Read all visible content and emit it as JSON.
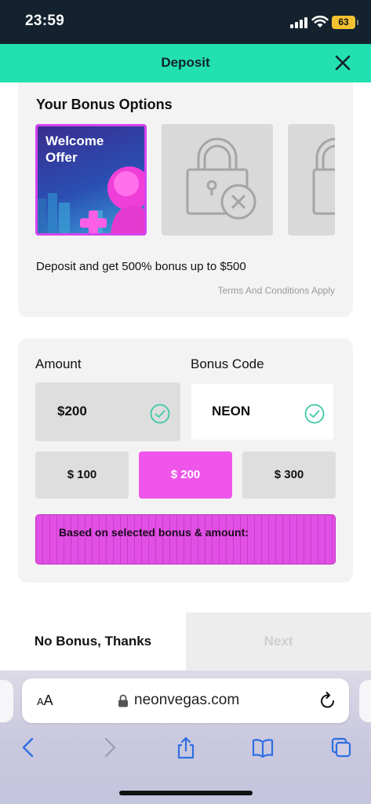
{
  "status_bar": {
    "time": "23:59",
    "battery": "63"
  },
  "header": {
    "title": "Deposit",
    "close_icon": "close-icon"
  },
  "bonus_options": {
    "title": "Your Bonus Options",
    "offers": [
      {
        "label": "Welcome Offer",
        "line1": "Welcome",
        "line2": "Offer",
        "state": "selected"
      },
      {
        "label": "",
        "state": "locked",
        "icon": "lock-x-icon"
      },
      {
        "label": "",
        "state": "locked",
        "icon": "lock-icon"
      }
    ],
    "description": "Deposit and get 500% bonus up to $500",
    "terms": "Terms And Conditions Apply"
  },
  "deposit": {
    "amount_label": "Amount",
    "bonus_code_label": "Bonus Code",
    "amount_value": "$200",
    "bonus_code_value": "NEON",
    "presets": [
      "$ 100",
      "$ 200",
      "$ 300"
    ],
    "selected_preset": "$ 200",
    "info_text": "Based on selected bonus & amount:"
  },
  "actions": {
    "no_bonus": "No Bonus, Thanks",
    "next": "Next"
  },
  "browser": {
    "aa_large": "A",
    "aa_small": "A",
    "url": "neonvegas.com"
  },
  "colors": {
    "header": "#22e0b0",
    "status_bar": "#13222e",
    "accent_pink": "#ef55ea",
    "check": "#3ec9a6"
  }
}
